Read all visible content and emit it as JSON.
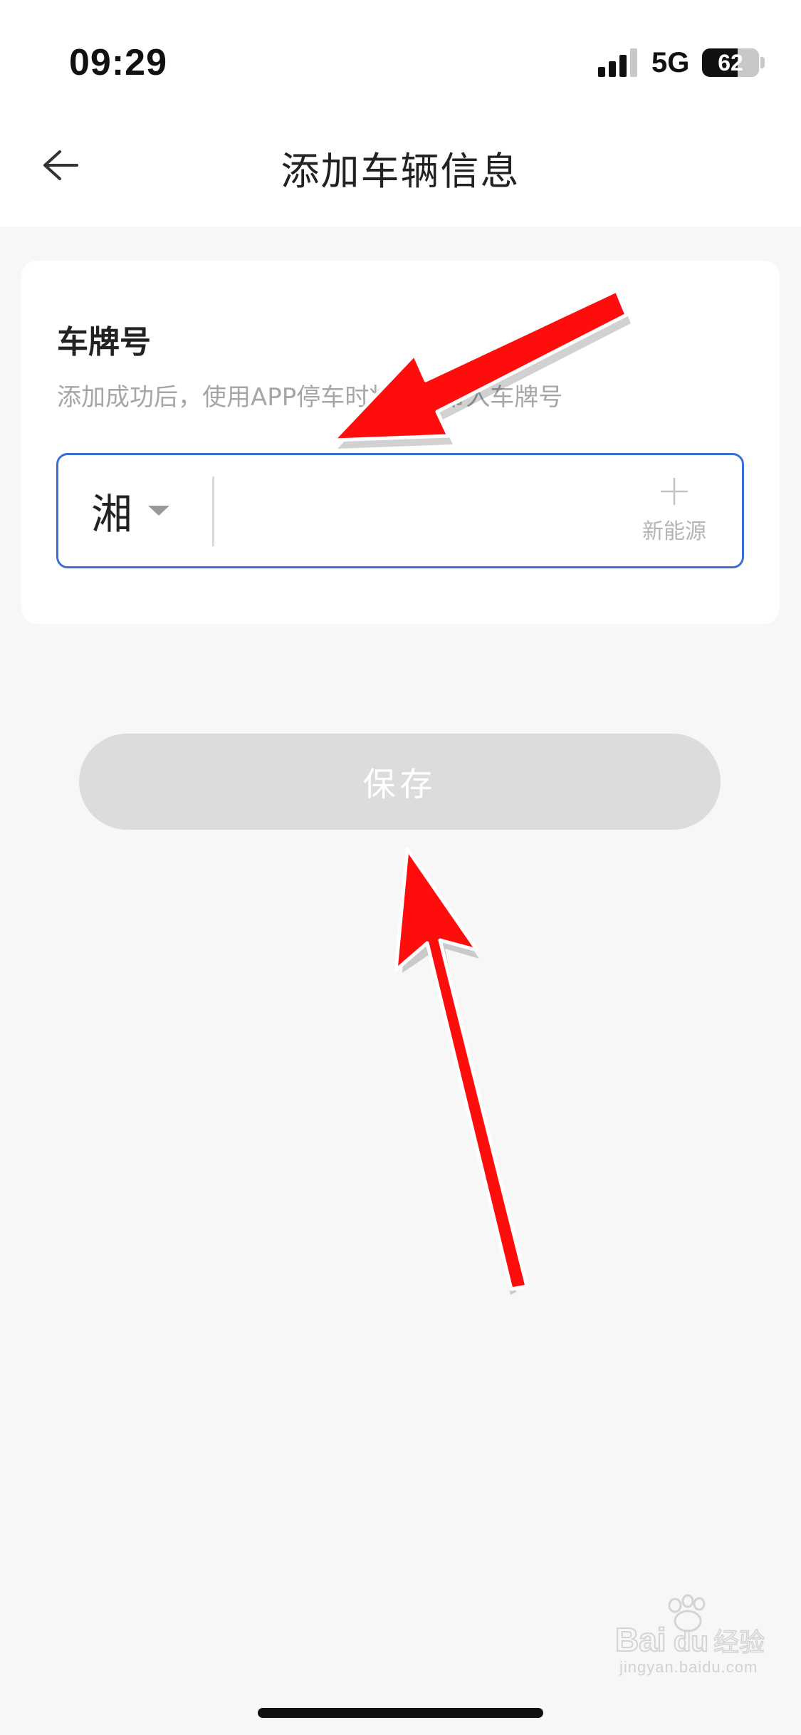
{
  "status_bar": {
    "time": "09:29",
    "network": "5G",
    "battery_percent": 62,
    "battery_label": "62"
  },
  "nav": {
    "title": "添加车辆信息",
    "back_icon": "arrow-left-icon"
  },
  "card": {
    "title": "车牌号",
    "hint": "添加成功后，使用APP停车时将自动带入车牌号",
    "province_selected": "湘",
    "plate_value": "",
    "new_energy_label": "新能源",
    "new_energy_icon": "plus-icon"
  },
  "actions": {
    "save_label": "保存"
  },
  "watermark": {
    "brand": "Bai du 经验",
    "site": "jingyan.baidu.com"
  },
  "colors": {
    "input_border": "#3a6fd8",
    "save_button_disabled": "#dcdcdc",
    "annotation_arrow": "#ff0000",
    "page_background": "#f7f7f7"
  }
}
